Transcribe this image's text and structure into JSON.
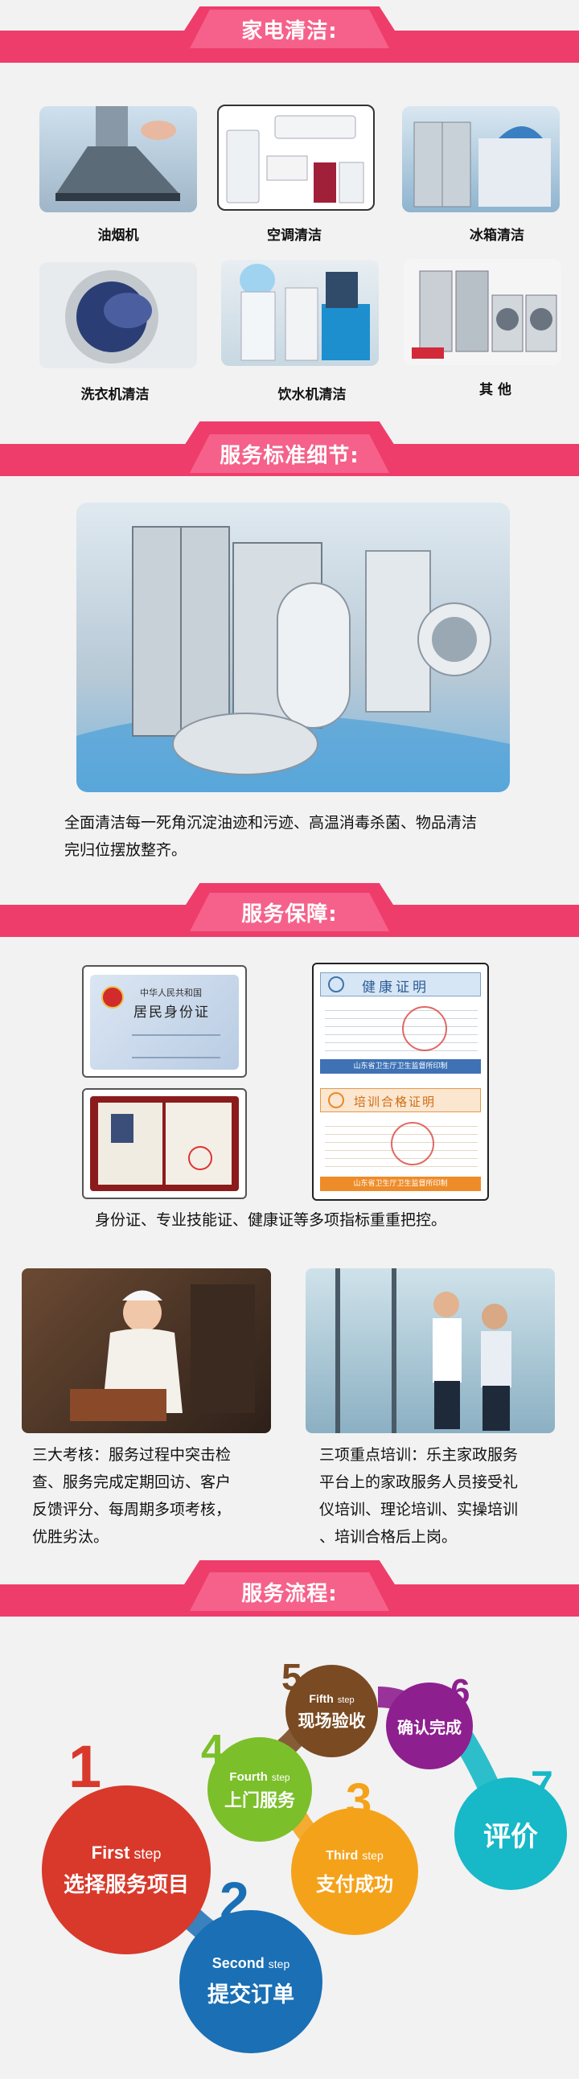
{
  "sections": {
    "s1": "家电清洁:",
    "s2": "服务标准细节:",
    "s3": "服务保障:",
    "s4": "服务流程:"
  },
  "appliances": [
    {
      "label": "油烟机",
      "icon": "range-hood"
    },
    {
      "label": "空调清洁",
      "icon": "air-conditioner"
    },
    {
      "label": "冰箱清洁",
      "icon": "refrigerator"
    },
    {
      "label": "洗衣机清洁",
      "icon": "washing-machine"
    },
    {
      "label": "饮水机清洁",
      "icon": "water-dispenser"
    },
    {
      "label": "其 他",
      "icon": "appliance-set"
    }
  ],
  "standard": {
    "text1": "全面清洁每一死角沉淀油迹和污迹、高温消毒杀菌、物品清洁",
    "text2": "完归位摆放整齐。"
  },
  "guarantee": {
    "idcard_line1": "中华人民共和国",
    "idcard_line2": "居民身份证",
    "health_title": "健康证明",
    "health_footer": "山东省卫生厅卫生监督所印制",
    "training_title": "培训合格证明",
    "training_footer": "山东省卫生厅卫生监督所印制",
    "caption": "身份证、专业技能证、健康证等多项指标重重把控。",
    "left_text": [
      "三大考核：服务过程中突击检",
      "查、服务完成定期回访、客户",
      "反馈评分、每周期多项考核，",
      "优胜劣汰。"
    ],
    "right_text": [
      "三项重点培训：乐主家政服务",
      "平台上的家政服务人员接受礼",
      "仪培训、理论培训、实操培训",
      "、培训合格后上岗。"
    ]
  },
  "process": [
    {
      "num": "1",
      "en": "First",
      "en_small": "step",
      "cn": "选择服务项目",
      "color": "#d8392b"
    },
    {
      "num": "2",
      "en": "Second",
      "en_small": "step",
      "cn": "提交订单",
      "color": "#1a6fb5"
    },
    {
      "num": "3",
      "en": "Third",
      "en_small": "step",
      "cn": "支付成功",
      "color": "#f5a21b"
    },
    {
      "num": "4",
      "en": "Fourth",
      "en_small": "step",
      "cn": "上门服务",
      "color": "#7bbf2a"
    },
    {
      "num": "5",
      "en": "Fifth",
      "en_small": "step",
      "cn": "现场验收",
      "color": "#7a4a22"
    },
    {
      "num": "6",
      "en": "",
      "en_small": "",
      "cn": "确认完成",
      "color": "#8e1f8f"
    },
    {
      "num": "7",
      "en": "",
      "en_small": "",
      "cn": "评价",
      "color": "#17b8c7"
    }
  ]
}
